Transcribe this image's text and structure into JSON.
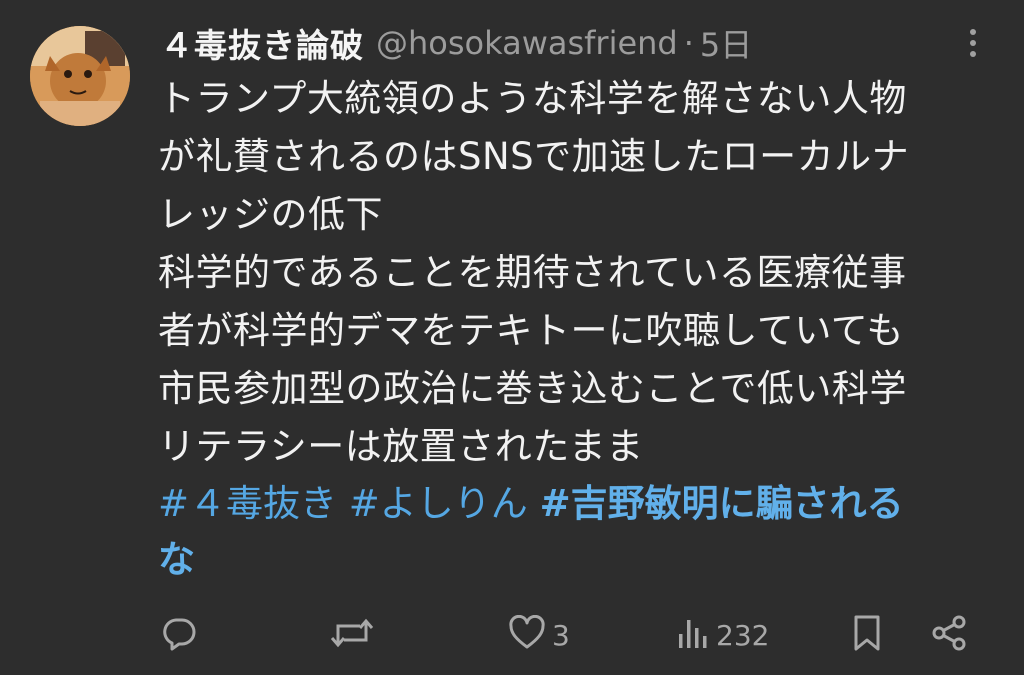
{
  "tweet": {
    "display_name": "４毒抜き論破",
    "handle": "@hosokawasfriend",
    "separator": "·",
    "time": "5日",
    "lines": [
      "トランプ大統領のような科学を解さない人物",
      "が礼賛されるのはSNSで加速したローカルナ",
      "レッジの低下",
      "科学的であることを期待されている医療従事",
      "者が科学的デマをテキトーに吹聴していても",
      "市民参加型の政治に巻き込むことで低い科学",
      "リテラシーは放置されたまま"
    ],
    "hashtags": {
      "tag1": "#４毒抜き",
      "tag2": "#よしりん",
      "tag3_line1": "#吉野敏明に騙される",
      "tag3_line2": "な"
    }
  },
  "actions": {
    "reply_count": "",
    "retweet_count": "",
    "like_count": "3",
    "views_count": "232"
  },
  "icons": {
    "avatar": "avatar-image",
    "more": "more-options-icon",
    "reply": "reply-icon",
    "retweet": "retweet-icon",
    "like": "heart-icon",
    "views": "views-icon",
    "bookmark": "bookmark-icon",
    "share": "share-icon"
  },
  "colors": {
    "background": "#2d2d2d",
    "text": "#f2f2f2",
    "muted": "#9c9c9c",
    "hashtag": "#55a7e3"
  }
}
